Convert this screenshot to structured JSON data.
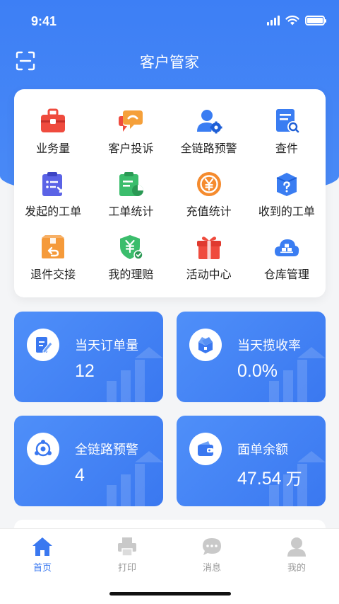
{
  "status_bar": {
    "time": "9:41"
  },
  "header": {
    "title": "客户管家",
    "scan_icon": "scan-icon"
  },
  "colors": {
    "primary": "#3a78f0",
    "accent_red": "#ef4b3e",
    "accent_orange": "#f5a03a",
    "accent_green": "#3bbd6c",
    "accent_purple": "#5b63e6",
    "accent_blue": "#3a7df2"
  },
  "menu": [
    {
      "label": "业务量",
      "icon": "briefcase-icon"
    },
    {
      "label": "客户投诉",
      "icon": "complaint-chat-icon"
    },
    {
      "label": "全链路预警",
      "icon": "user-settings-icon"
    },
    {
      "label": "查件",
      "icon": "document-search-icon"
    },
    {
      "label": "发起的工单",
      "icon": "clipboard-tools-icon"
    },
    {
      "label": "工单统计",
      "icon": "clipboard-chart-icon"
    },
    {
      "label": "充值统计",
      "icon": "yen-coin-icon"
    },
    {
      "label": "收到的工单",
      "icon": "package-question-icon"
    },
    {
      "label": "退件交接",
      "icon": "box-return-icon"
    },
    {
      "label": "我的理赔",
      "icon": "shield-yen-icon"
    },
    {
      "label": "活动中心",
      "icon": "gift-icon"
    },
    {
      "label": "仓库管理",
      "icon": "warehouse-cloud-icon"
    }
  ],
  "stats": [
    {
      "label": "当天订单量",
      "value": "12",
      "unit": "",
      "icon": "edit-note-icon"
    },
    {
      "label": "当天揽收率",
      "value": "0.0%",
      "unit": "",
      "icon": "box-open-icon"
    },
    {
      "label": "全链路预警",
      "value": "4",
      "unit": "",
      "icon": "network-nodes-icon"
    },
    {
      "label": "面单余额",
      "value": "47.54",
      "unit": "万",
      "icon": "wallet-icon"
    }
  ],
  "tabs": [
    {
      "label": "首页",
      "icon": "home-icon",
      "active": true
    },
    {
      "label": "打印",
      "icon": "printer-icon",
      "active": false
    },
    {
      "label": "消息",
      "icon": "message-icon",
      "active": false
    },
    {
      "label": "我的",
      "icon": "profile-icon",
      "active": false
    }
  ]
}
